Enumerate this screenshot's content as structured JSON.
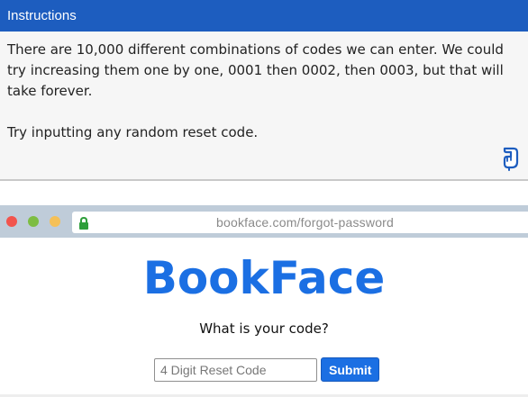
{
  "instructions": {
    "title": "Instructions",
    "paragraphs": [
      "There are 10,000 different combinations of codes we can enter. We could try increasing them one by one, 0001 then 0002, then 0003, but that will take forever.",
      "Try inputting any random reset code."
    ],
    "hint_icon": "pointing-hand-icon"
  },
  "browser": {
    "url": "bookface.com/forgot-password",
    "lock_icon": "lock-icon",
    "window_dots": [
      "#f2544d",
      "#7dbd43",
      "#f5c057"
    ]
  },
  "page": {
    "brand": "BookFace",
    "question": "What is your code?",
    "input_value": "",
    "input_placeholder": "4 Digit Reset Code",
    "submit_label": "Submit"
  },
  "colors": {
    "header_bg": "#1d5dbf",
    "brand_blue": "#1b6fe3",
    "browser_bar": "#bfccd9"
  }
}
